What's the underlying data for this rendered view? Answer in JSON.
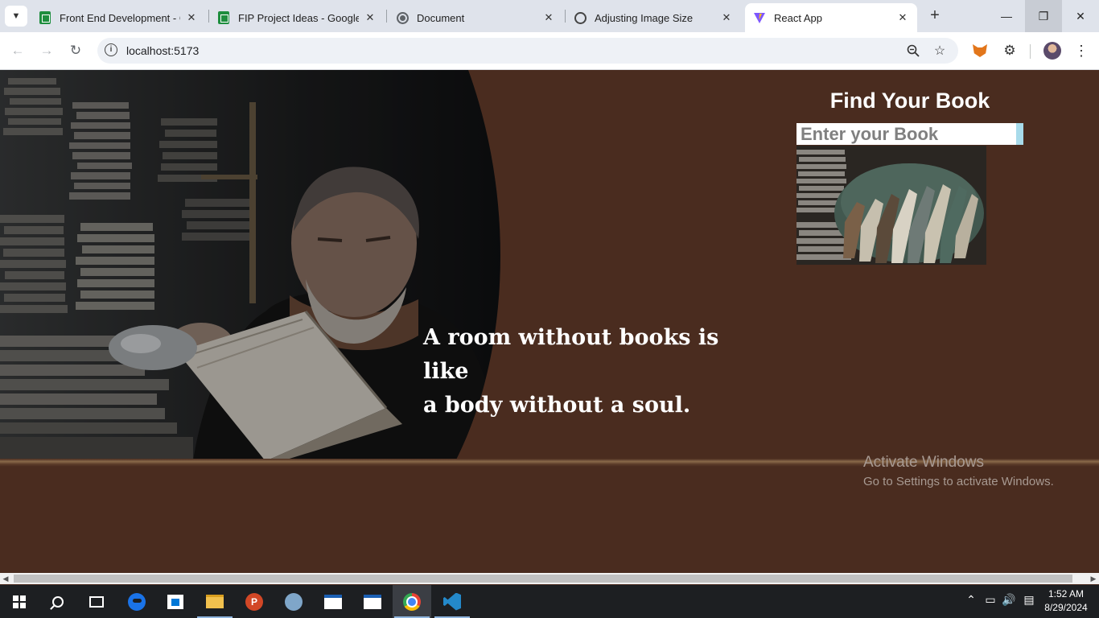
{
  "browser": {
    "tabs": [
      {
        "title": "Front End Development - Go",
        "icon": "google-sheets-icon",
        "active": false
      },
      {
        "title": "FIP Project Ideas - Google Sl",
        "icon": "google-sheets-icon",
        "active": false
      },
      {
        "title": "Document",
        "icon": "globe-icon",
        "active": false
      },
      {
        "title": "Adjusting Image Size",
        "icon": "chatgpt-icon",
        "active": false
      },
      {
        "title": "React App",
        "icon": "vite-icon",
        "active": true
      }
    ],
    "url": "localhost:5173"
  },
  "page": {
    "finder_title": "Find Your Book",
    "search_placeholder": "Enter your Book",
    "quote_line1": "A room without books is like",
    "quote_line2": "a body without a soul."
  },
  "watermark": {
    "line1": "Activate Windows",
    "line2": "Go to Settings to activate Windows."
  },
  "taskbar": {
    "time": "1:52 AM",
    "date": "8/29/2024"
  },
  "colors": {
    "page_background": "#4a2c1f",
    "input_accent": "#a8dbea"
  }
}
